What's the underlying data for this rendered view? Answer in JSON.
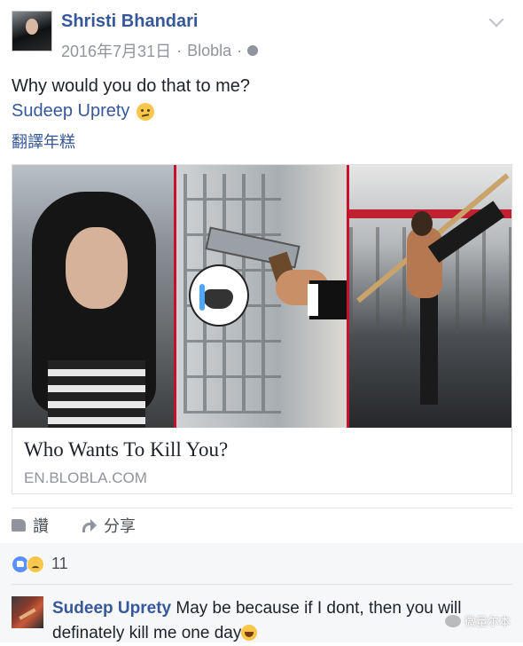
{
  "post": {
    "author": "Shristi Bhandari",
    "date": "2016年7月31日",
    "meta_sep": "·",
    "app": "Blobla",
    "text": "Why would you do that to me?",
    "mention": "Sudeep Uprety",
    "translate": "翻譯年糕"
  },
  "link": {
    "title": "Who Wants To Kill You?",
    "domain": "EN.BLOBLA.COM"
  },
  "actions": {
    "like": "讚",
    "share": "分享"
  },
  "reactions": {
    "count": "11"
  },
  "comment": {
    "author": "Sudeep Uprety",
    "text": "May be because if I dont, then you will definately kill me one day"
  },
  "watermark": {
    "text": "微量尔本"
  },
  "colors": {
    "link_blue": "#365899",
    "meta_gray": "#90949c",
    "reaction_bg": "#f6f7f9"
  }
}
